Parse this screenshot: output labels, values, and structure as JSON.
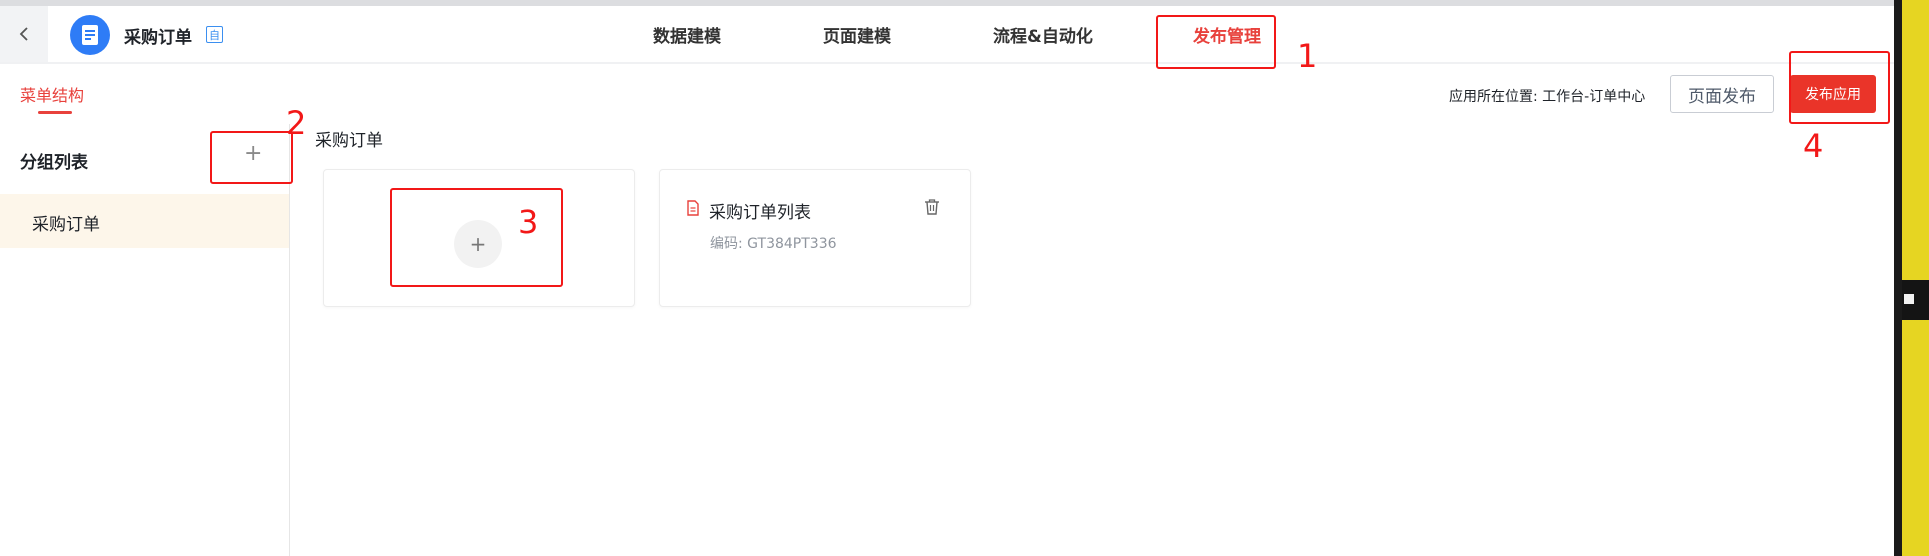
{
  "header": {
    "app_name": "采购订单",
    "app_badge": "自",
    "tabs": [
      {
        "label": "数据建模",
        "active": false
      },
      {
        "label": "页面建模",
        "active": false
      },
      {
        "label": "流程&自动化",
        "active": false
      },
      {
        "label": "发布管理",
        "active": true
      }
    ]
  },
  "sidebar": {
    "tab_label": "菜单结构",
    "group_title": "分组列表",
    "add_symbol": "+",
    "items": [
      {
        "label": "采购订单"
      }
    ]
  },
  "main": {
    "section_title": "采购订单",
    "add_symbol": "+",
    "pages": [
      {
        "title": "采购订单列表",
        "code": "编码: GT384PT336"
      }
    ]
  },
  "actions": {
    "location_text": "应用所在位置: 工作台-订单中心",
    "page_publish_label": "页面发布",
    "publish_app_label": "发布应用"
  },
  "annotations": [
    "1",
    "2",
    "3",
    "4"
  ],
  "colors": {
    "accent": "#e8413c",
    "primary_button": "#ea3429",
    "annotation": "#f21818",
    "app_icon": "#2e7cf6",
    "sidebar_selected": "#fdf6ea"
  },
  "icons": [
    "chevron-left-icon",
    "document-list-icon",
    "plus-icon",
    "file-icon",
    "trash-icon"
  ]
}
